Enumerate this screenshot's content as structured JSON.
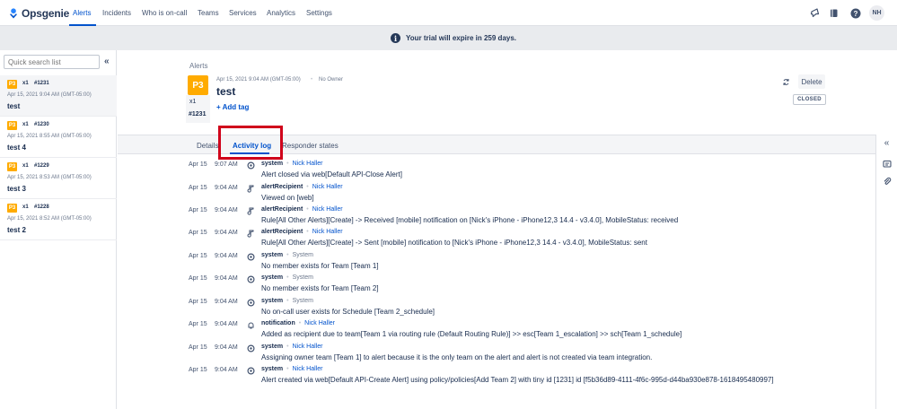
{
  "app": {
    "name": "Opsgenie",
    "brand_color": "#0052cc"
  },
  "nav": {
    "items": [
      "Alerts",
      "Incidents",
      "Who is on-call",
      "Teams",
      "Services",
      "Analytics",
      "Settings"
    ],
    "active": "Alerts",
    "icons": [
      "megaphone-icon",
      "book-icon",
      "help-icon"
    ],
    "avatar_initials": "NH"
  },
  "banner": {
    "message": "Your trial will expire in 259 days.",
    "icon": "info-icon"
  },
  "list": {
    "search_placeholder": "Quick search list",
    "alerts": [
      {
        "priority": "P3",
        "count": "x1",
        "id": "#1231",
        "date": "Apr 15, 2021 9:04 AM (GMT-05:00)",
        "message": "test",
        "selected": true
      },
      {
        "priority": "P3",
        "count": "x1",
        "id": "#1230",
        "date": "Apr 15, 2021 8:55 AM (GMT-05:00)",
        "message": "test 4",
        "selected": false
      },
      {
        "priority": "P3",
        "count": "x1",
        "id": "#1229",
        "date": "Apr 15, 2021 8:53 AM (GMT-05:00)",
        "message": "test 3",
        "selected": false
      },
      {
        "priority": "P3",
        "count": "x1",
        "id": "#1228",
        "date": "Apr 15, 2021 8:52 AM (GMT-05:00)",
        "message": "test 2",
        "selected": false
      }
    ]
  },
  "detail": {
    "breadcrumb": "Alerts",
    "priority": "P3",
    "count": "x1",
    "id": "#1231",
    "date": "Apr 15, 2021 9:04 AM (GMT-05:00)",
    "owner": "No Owner",
    "title": "test",
    "add_tag": "+ Add tag",
    "delete_label": "Delete",
    "status": "CLOSED"
  },
  "tabs": [
    {
      "label": "Details",
      "active": false
    },
    {
      "label": "Activity log",
      "active": true
    },
    {
      "label": "Responder states",
      "active": false
    }
  ],
  "activity": [
    {
      "date": "Apr 15",
      "time": "9:07 AM",
      "icon": "system-gear-icon",
      "actor": "system",
      "user": "Nick Haller",
      "user_link": true,
      "text": "Alert closed via web[Default API-Close Alert]"
    },
    {
      "date": "Apr 15",
      "time": "9:04 AM",
      "icon": "recipient-icon",
      "actor": "alertRecipient",
      "user": "Nick Haller",
      "user_link": true,
      "text": "Viewed on [web]"
    },
    {
      "date": "Apr 15",
      "time": "9:04 AM",
      "icon": "recipient-icon",
      "actor": "alertRecipient",
      "user": "Nick Haller",
      "user_link": true,
      "text": "Rule[All Other Alerts][Create] -> Received [mobile] notification on [Nick's iPhone - iPhone12,3 14.4 - v3.4.0], MobileStatus: received"
    },
    {
      "date": "Apr 15",
      "time": "9:04 AM",
      "icon": "recipient-icon",
      "actor": "alertRecipient",
      "user": "Nick Haller",
      "user_link": true,
      "text": "Rule[All Other Alerts][Create] -> Sent [mobile] notification to [Nick's iPhone - iPhone12,3 14.4 - v3.4.0], MobileStatus: sent"
    },
    {
      "date": "Apr 15",
      "time": "9:04 AM",
      "icon": "system-gear-icon",
      "actor": "system",
      "user": "System",
      "user_link": false,
      "text": "No member exists for Team [Team 1]"
    },
    {
      "date": "Apr 15",
      "time": "9:04 AM",
      "icon": "system-gear-icon",
      "actor": "system",
      "user": "System",
      "user_link": false,
      "text": "No member exists for Team [Team 2]"
    },
    {
      "date": "Apr 15",
      "time": "9:04 AM",
      "icon": "system-gear-icon",
      "actor": "system",
      "user": "System",
      "user_link": false,
      "text": "No on-call user exists for Schedule [Team 2_schedule]"
    },
    {
      "date": "Apr 15",
      "time": "9:04 AM",
      "icon": "bell-icon",
      "actor": "notification",
      "user": "Nick Haller",
      "user_link": true,
      "text": "Added as recipient due to team[Team 1 via routing rule (Default Routing Rule)] >> esc[Team 1_escalation] >> sch[Team 1_schedule]"
    },
    {
      "date": "Apr 15",
      "time": "9:04 AM",
      "icon": "system-gear-icon",
      "actor": "system",
      "user": "Nick Haller",
      "user_link": true,
      "text": "Assigning owner team [Team 1] to alert because it is the only team on the alert and alert is not created via team integration."
    },
    {
      "date": "Apr 15",
      "time": "9:04 AM",
      "icon": "system-gear-icon",
      "actor": "system",
      "user": "Nick Haller",
      "user_link": true,
      "text": "Alert created via web[Default API-Create Alert] using policy/policies[Add Team 2] with tiny id [1231] id [f5b36d89-4111-4f6c-995d-d44ba930e878-1618495480997]"
    }
  ]
}
